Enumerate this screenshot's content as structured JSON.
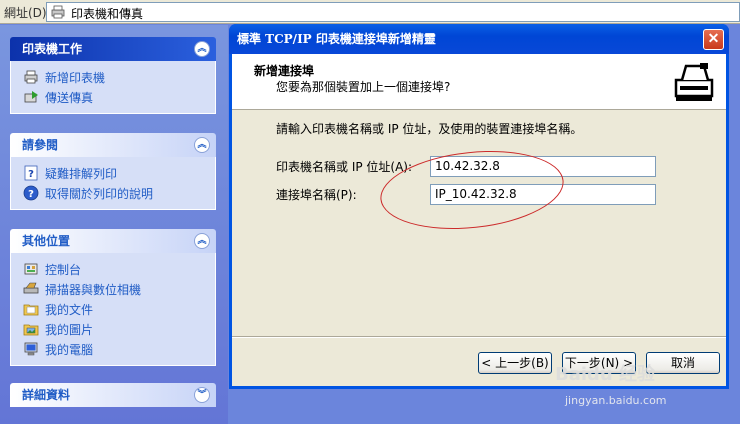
{
  "address_bar": {
    "label": "網址(D)",
    "value": "印表機和傳真"
  },
  "task_pane": {
    "groups": [
      {
        "title": "印表機工作",
        "items": [
          {
            "label": "新增印表機",
            "icon": "add-printer-icon"
          },
          {
            "label": "傳送傳真",
            "icon": "send-fax-icon"
          }
        ]
      },
      {
        "title": "請參閱",
        "items": [
          {
            "label": "疑難排解列印",
            "icon": "help-icon"
          },
          {
            "label": "取得關於列印的說明",
            "icon": "help-icon"
          }
        ]
      },
      {
        "title": "其他位置",
        "items": [
          {
            "label": "控制台",
            "icon": "control-panel-icon"
          },
          {
            "label": "掃描器與數位相機",
            "icon": "scanner-icon"
          },
          {
            "label": "我的文件",
            "icon": "folder-icon"
          },
          {
            "label": "我的圖片",
            "icon": "pictures-icon"
          },
          {
            "label": "我的電腦",
            "icon": "computer-icon"
          }
        ]
      },
      {
        "title": "詳細資料",
        "items": []
      }
    ]
  },
  "dialog": {
    "title": "標準 TCP/IP 印表機連接埠新增精靈",
    "header_title": "新增連接埠",
    "header_subtitle": "您要為那個裝置加上一個連接埠?",
    "instruction": "請輸入印表機名稱或 IP 位址，及使用的裝置連接埠名稱。",
    "fields": [
      {
        "label": "印表機名稱或 IP 位址(A):",
        "value": "10.42.32.8"
      },
      {
        "label": "連接埠名稱(P):",
        "value": "IP_10.42.32.8"
      }
    ],
    "buttons": {
      "back": "< 上一步(B)",
      "next": "下一步(N) >",
      "cancel": "取消"
    }
  },
  "watermark": {
    "brand": "Baidu 经验",
    "url": "jingyan.baidu.com"
  },
  "colors": {
    "desktop_blue": "#6b85dc",
    "title_blue": "#0054e3",
    "annotation_red": "#cc2b2b"
  }
}
